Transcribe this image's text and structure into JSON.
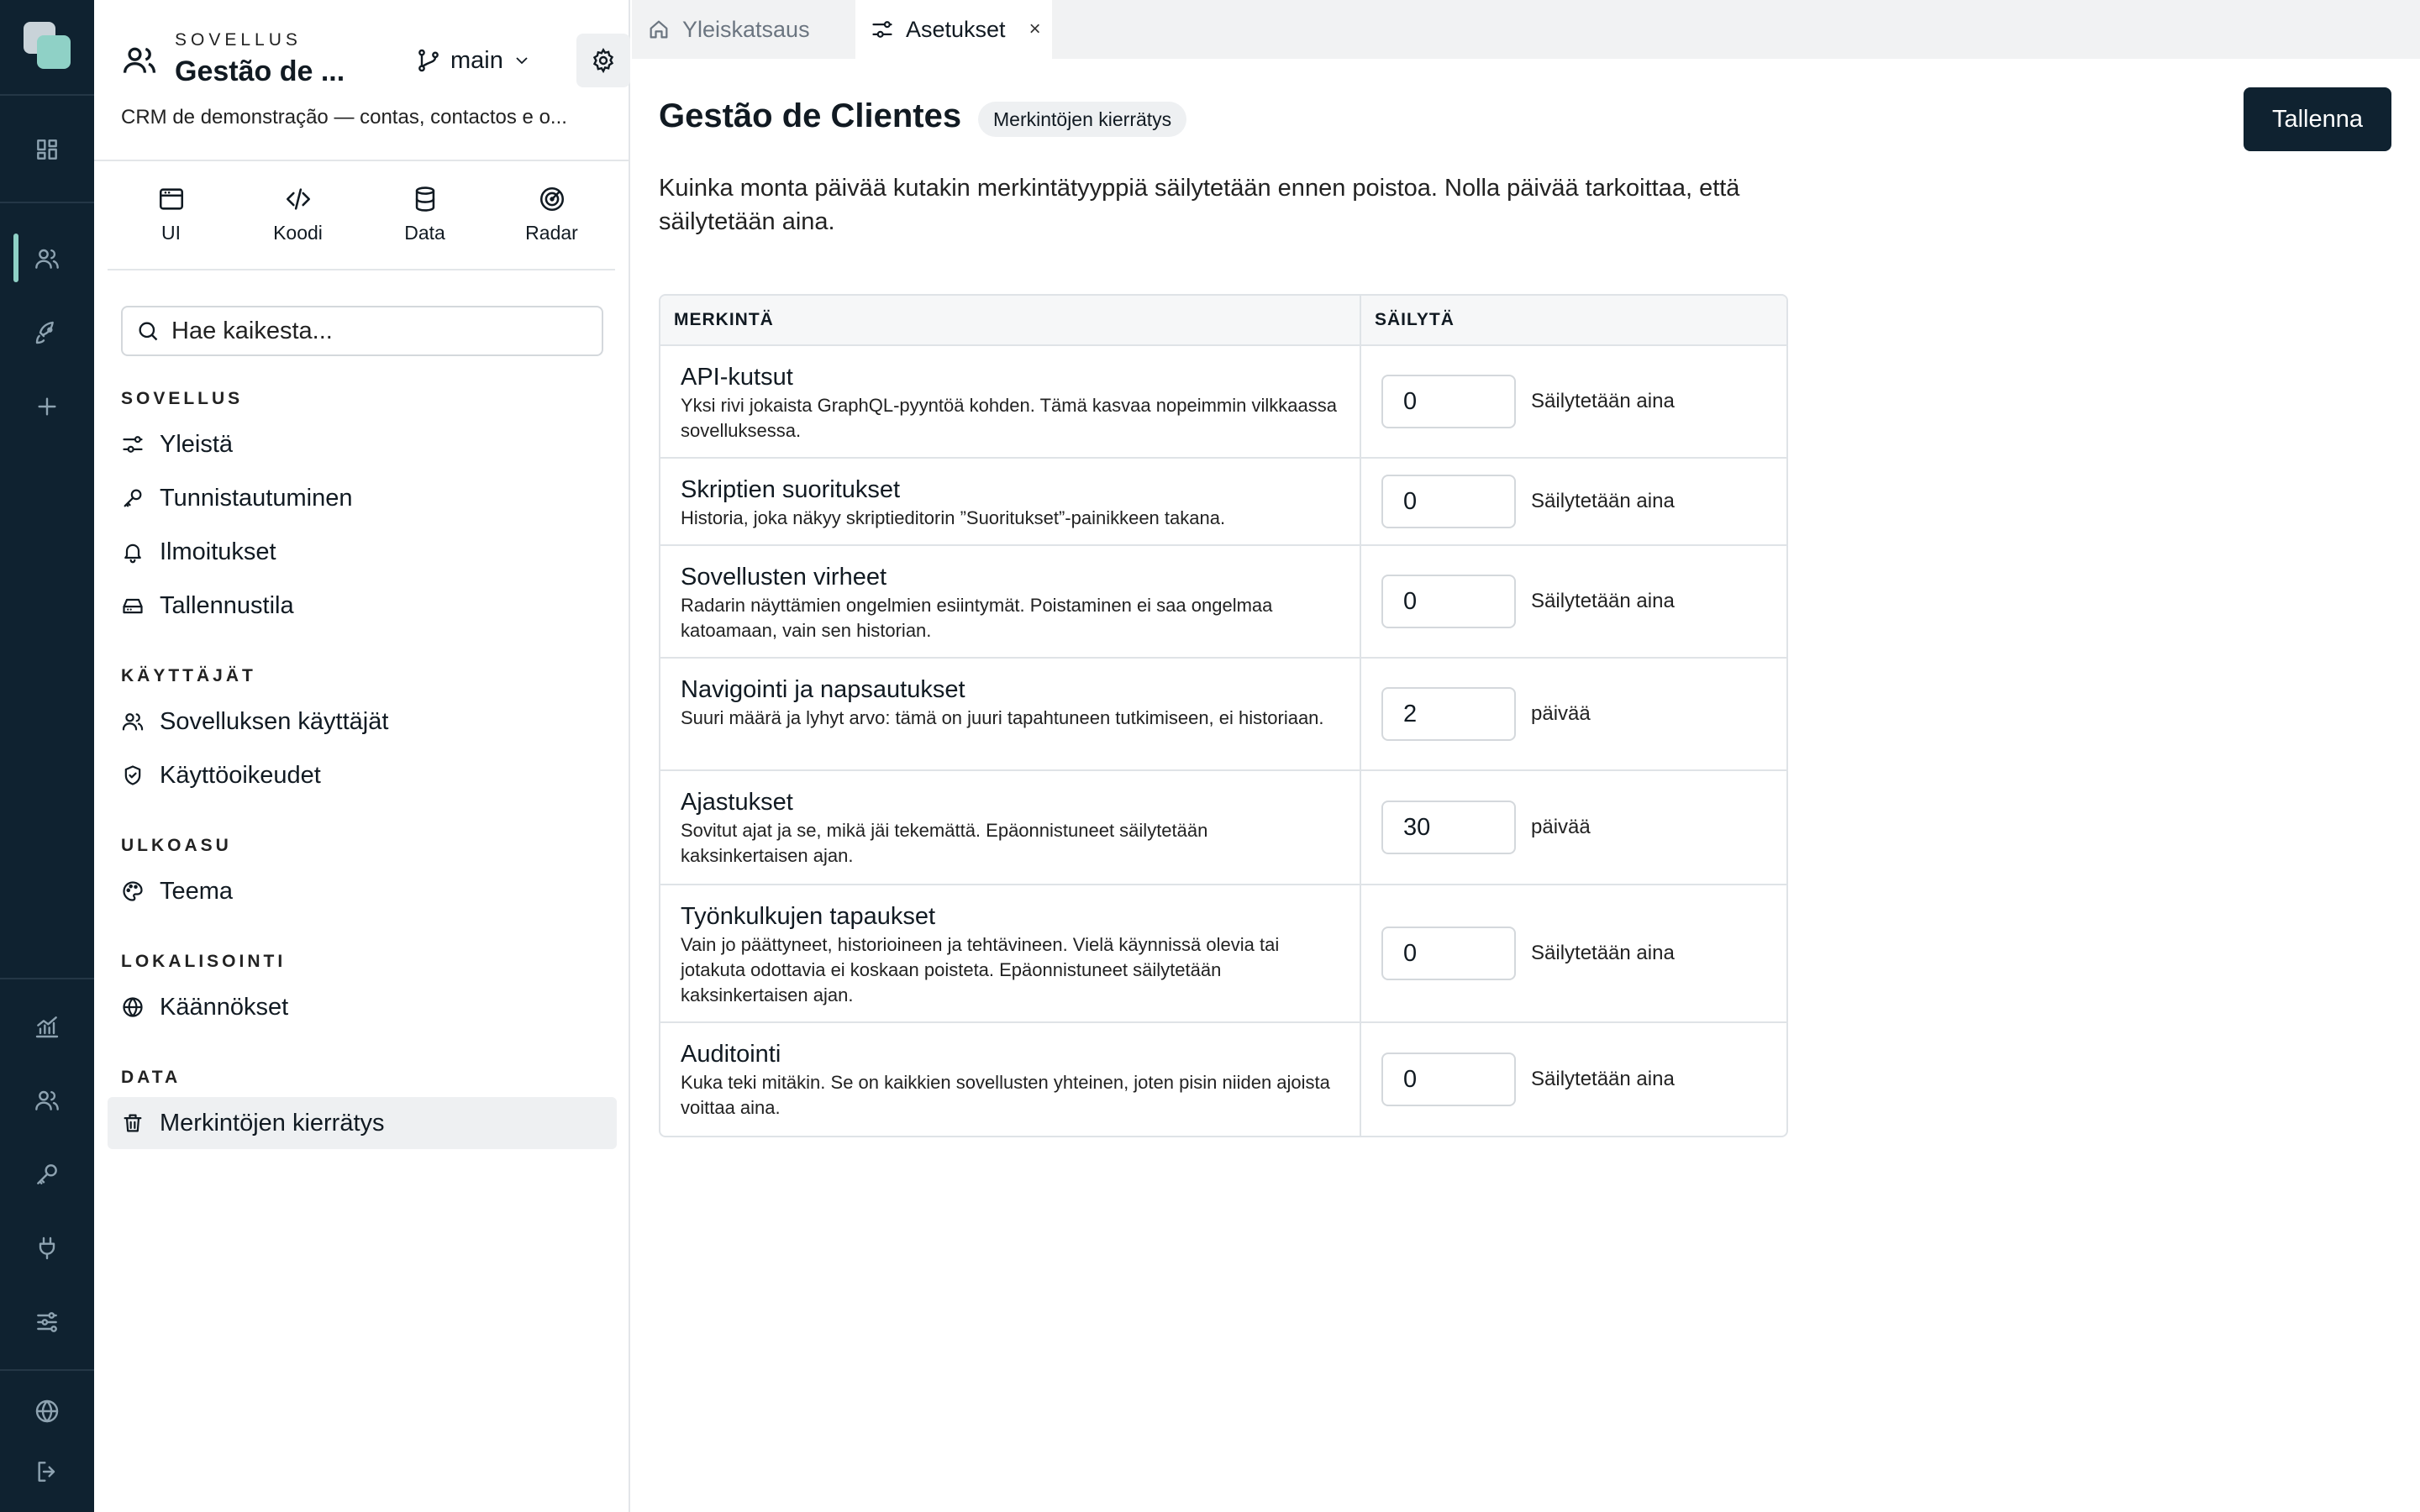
{
  "sidebar": {
    "app_kicker": "SOVELLUS",
    "app_name": "Gestão de ...",
    "branch": "main",
    "app_description": "CRM de demonstração — contas, contactos e o...",
    "quick": [
      {
        "label": "UI"
      },
      {
        "label": "Koodi"
      },
      {
        "label": "Data"
      },
      {
        "label": "Radar"
      }
    ],
    "search_placeholder": "Hae kaikesta...",
    "sections": {
      "sovellus": "SOVELLUS",
      "kayttajat": "KÄYTTÄJÄT",
      "ulkoasu": "ULKOASU",
      "lokalisointi": "LOKALISOINTI",
      "data": "DATA"
    },
    "items": {
      "yleista": "Yleistä",
      "tunnistautuminen": "Tunnistautuminen",
      "ilmoitukset": "Ilmoitukset",
      "tallennustila": "Tallennustila",
      "sovelluksen_kayttajat": "Sovelluksen käyttäjät",
      "kayttooikeudet": "Käyttöoikeudet",
      "teema": "Teema",
      "kaannokset": "Käännökset",
      "merkintojen_kierratys": "Merkintöjen kierrätys"
    }
  },
  "tabs": {
    "overview": "Yleiskatsaus",
    "settings": "Asetukset",
    "close": "×"
  },
  "main": {
    "title": "Gestão de Clientes",
    "badge": "Merkintöjen kierrätys",
    "save_label": "Tallenna",
    "intro": "Kuinka monta päivää kutakin merkintätyyppiä säilytetään ennen poistoa. Nolla päivää tarkoittaa, että säilytetään aina.",
    "table": {
      "col_entry": "MERKINTÄ",
      "col_keep": "SÄILYTÄ",
      "rows": [
        {
          "title": "API-kutsut",
          "desc": "Yksi rivi jokaista GraphQL-pyyntöä kohden. Tämä kasvaa nopeimmin vilkkaassa sovelluksessa.",
          "value": "0",
          "unit": "Säilytetään aina"
        },
        {
          "title": "Skriptien suoritukset",
          "desc": "Historia, joka näkyy skriptieditorin ”Suoritukset”-painikkeen takana.",
          "value": "0",
          "unit": "Säilytetään aina"
        },
        {
          "title": "Sovellusten virheet",
          "desc": "Radarin näyttämien ongelmien esiintymät. Poistaminen ei saa ongelmaa katoamaan, vain sen historian.",
          "value": "0",
          "unit": "Säilytetään aina"
        },
        {
          "title": "Navigointi ja napsautukset",
          "desc": "Suuri määrä ja lyhyt arvo: tämä on juuri tapahtuneen tutkimiseen, ei historiaan.",
          "value": "2",
          "unit": "päivää"
        },
        {
          "title": "Ajastukset",
          "desc": "Sovitut ajat ja se, mikä jäi tekemättä. Epäonnistuneet säilytetään kaksinkertaisen ajan.",
          "value": "30",
          "unit": "päivää"
        },
        {
          "title": "Työnkulkujen tapaukset",
          "desc": "Vain jo päättyneet, historioineen ja tehtävineen. Vielä käynnissä olevia tai jotakuta odottavia ei koskaan poisteta. Epäonnistuneet säilytetään kaksinkertaisen ajan.",
          "value": "0",
          "unit": "Säilytetään aina"
        },
        {
          "title": "Auditointi",
          "desc": "Kuka teki mitäkin. Se on kaikkien sovellusten yhteinen, joten pisin niiden ajoista voittaa aina.",
          "value": "0",
          "unit": "Säilytetään aina"
        }
      ]
    }
  },
  "colors": {
    "rail_bg": "#0f2230",
    "accent": "#8fd1c6",
    "primary_button": "#0f2230"
  }
}
